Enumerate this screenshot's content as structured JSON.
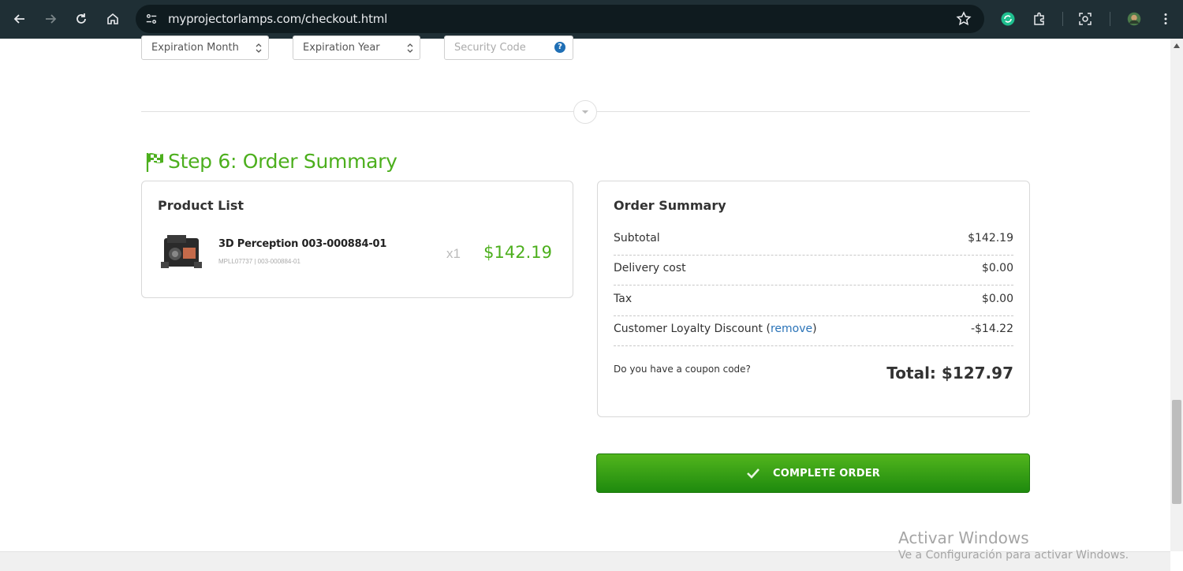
{
  "browser": {
    "url": "myprojectorlamps.com/checkout.html",
    "icons": [
      "back-icon",
      "forward-icon",
      "reload-icon",
      "home-icon",
      "site-info-icon",
      "bookmark-star-icon",
      "extension-sync-icon",
      "extensions-puzzle-icon",
      "screenshot-icon",
      "profile-avatar",
      "menu-dots-icon"
    ]
  },
  "payment": {
    "expiration_month": "Expiration Month",
    "expiration_year": "Expiration Year",
    "security_code_placeholder": "Security Code",
    "help_glyph": "?"
  },
  "step": {
    "title": "Step 6: Order Summary"
  },
  "product_list": {
    "title": "Product List",
    "items": [
      {
        "name": "3D Perception 003-000884-01",
        "sku": "MPLL07737 | 003-000884-01",
        "qty": "x1",
        "price": "$142.19"
      }
    ]
  },
  "order_summary": {
    "title": "Order Summary",
    "rows": [
      {
        "label": "Subtotal",
        "value": "$142.19"
      },
      {
        "label": "Delivery cost",
        "value": "$0.00"
      },
      {
        "label": "Tax",
        "value": "$0.00"
      }
    ],
    "discount": {
      "label": "Customer Loyalty Discount (",
      "link": "remove",
      "label_end": ")",
      "value": "-$14.22"
    },
    "coupon_prompt": "Do you have a coupon code?",
    "total": "Total: $127.97"
  },
  "actions": {
    "complete_order": "COMPLETE ORDER"
  },
  "watermark": {
    "line1": "Activar Windows",
    "line2": "Ve a Configuración para activar Windows."
  },
  "colors": {
    "accent_green": "#4caf1d",
    "browser_bar": "#1f2f35",
    "link_blue": "#2a73b8"
  }
}
